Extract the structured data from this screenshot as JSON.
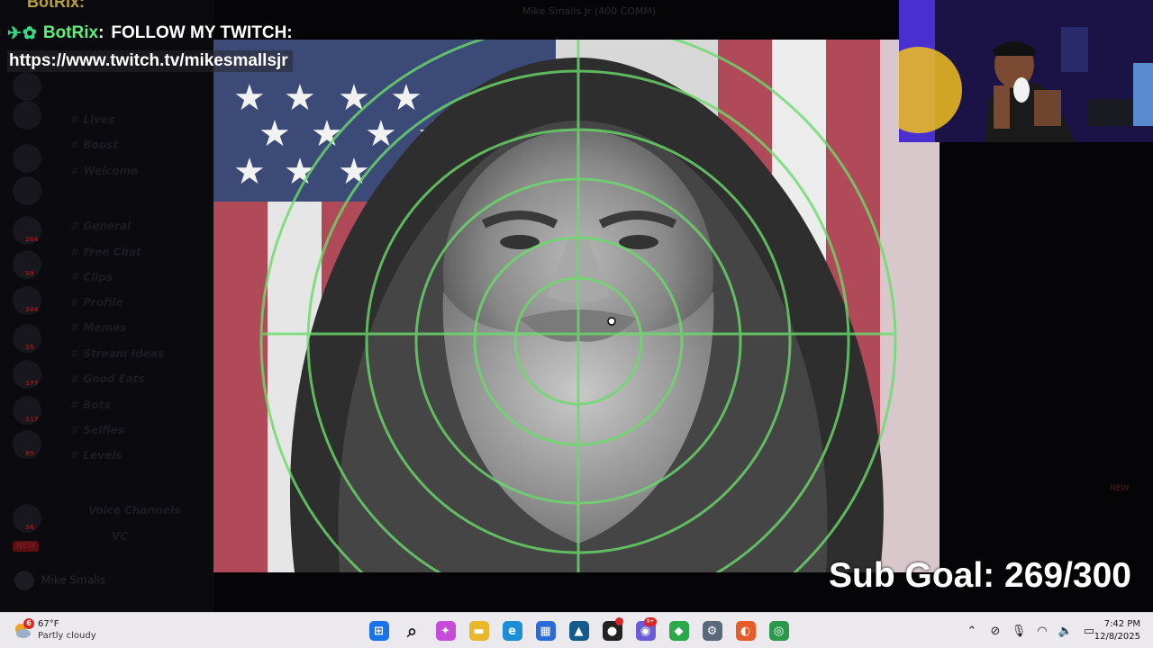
{
  "window_title": "Mike Smalls Jr (400 COMM)",
  "top_cut_text": "BotRix:",
  "chat_alert": {
    "icons": "✈✿",
    "bot_name": "BotRix",
    "separator": ":",
    "message": "FOLLOW MY TWITCH:",
    "link": "https://www.twitch.tv/mikesmallsjr"
  },
  "sidebar": {
    "channels": [
      {
        "label": "Lives"
      },
      {
        "label": "Boost"
      },
      {
        "label": "Welcome"
      },
      {
        "label": "General"
      },
      {
        "label": "Free Chat"
      },
      {
        "label": "Clips"
      },
      {
        "label": "Profile"
      },
      {
        "label": "Memes"
      },
      {
        "label": "Stream Ideas"
      },
      {
        "label": "Good Eats"
      },
      {
        "label": "Bots"
      },
      {
        "label": "Selfies"
      },
      {
        "label": "Levels"
      },
      {
        "label": "Voice Channels"
      },
      {
        "label": "VC"
      }
    ],
    "guild_badges": [
      "204",
      "99",
      "344",
      "25",
      "177",
      "317",
      "85",
      "36"
    ],
    "live_badge": "NEW",
    "user_name": "Mike Smalls"
  },
  "new_badge": "NEW",
  "sub_goal": "Sub Goal: 269/300",
  "taskbar": {
    "weather": {
      "badge": "6",
      "temp": "67°F",
      "desc": "Partly cloudy"
    },
    "apps": [
      {
        "name": "start-icon",
        "glyph": "⊞",
        "color": "#1a73e8"
      },
      {
        "name": "search-icon",
        "glyph": "⌕",
        "color": "#222222"
      },
      {
        "name": "copilot-icon",
        "glyph": "✦",
        "color": "#c64bd8"
      },
      {
        "name": "file-explorer-icon",
        "glyph": "▬",
        "color": "#e8b82a"
      },
      {
        "name": "edge-icon",
        "glyph": "e",
        "color": "#1b8fd6"
      },
      {
        "name": "store-icon",
        "glyph": "▦",
        "color": "#2a6bd8"
      },
      {
        "name": "pinned-app-icon",
        "glyph": "▲",
        "color": "#145a8a"
      },
      {
        "name": "media-app-icon",
        "glyph": "●",
        "color": "#222222"
      },
      {
        "name": "discord-icon",
        "glyph": "◉",
        "color": "#6a5cd8"
      },
      {
        "name": "green-app-icon",
        "glyph": "◆",
        "color": "#2aa84a"
      },
      {
        "name": "settings-icon",
        "glyph": "⚙",
        "color": "#5a6a7a"
      },
      {
        "name": "firefox-icon",
        "glyph": "◐",
        "color": "#e85a2a"
      },
      {
        "name": "chrome-icon",
        "glyph": "◎",
        "color": "#2a9a4a"
      }
    ],
    "discord_badge": "9+",
    "tray": [
      "chevron-up-icon",
      "network-off-icon",
      "microphone-icon",
      "wifi-icon",
      "volume-icon",
      "battery-icon"
    ],
    "tray_glyphs": [
      "⌃",
      "⊘",
      "🎙",
      "◠",
      "🔈",
      "▭"
    ],
    "time": "7:42 PM",
    "date": "12/8/2025"
  },
  "colors": {
    "bot_green": "#5ef07a",
    "crosshair_green": "#6adc6a",
    "taskbar": "#ece9ee"
  }
}
